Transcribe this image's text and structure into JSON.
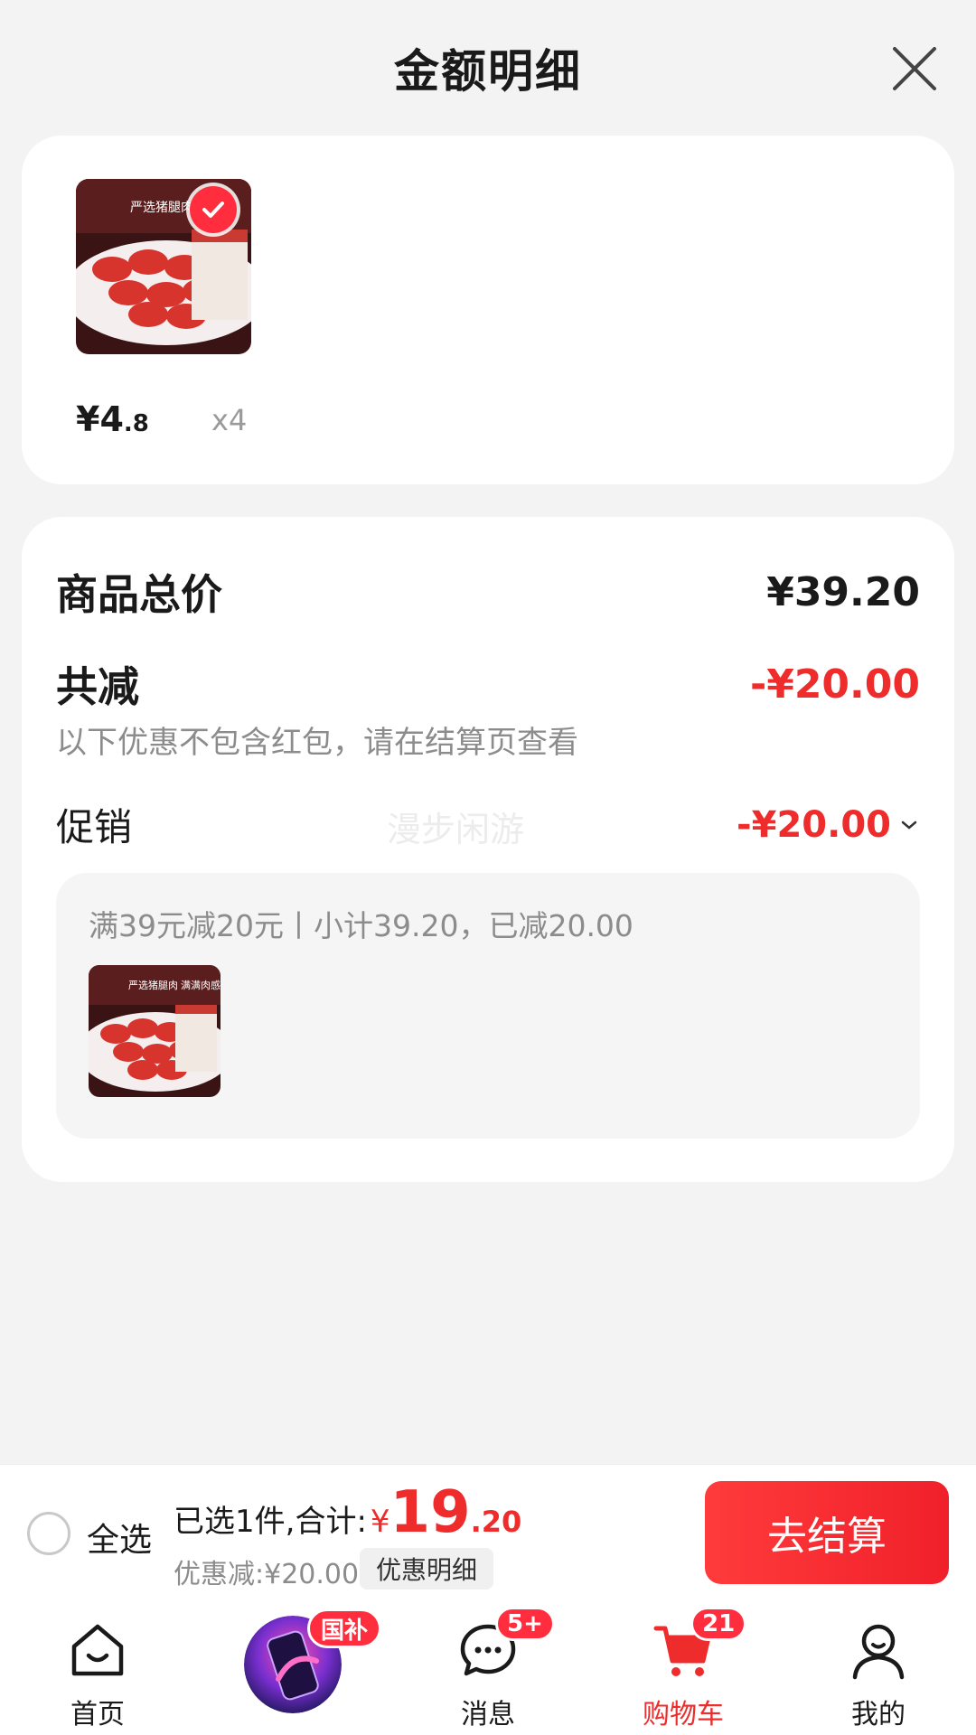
{
  "header": {
    "title": "金额明细"
  },
  "product": {
    "price_int": "¥4",
    "price_frac": ".8",
    "qty": "x4"
  },
  "summary": {
    "total_label": "商品总价",
    "total_value": "¥39.20",
    "discount_label": "共减",
    "discount_value": "-¥20.00",
    "note": "以下优惠不包含红包，请在结算页查看",
    "promo_label": "促销",
    "promo_value": "-¥20.00",
    "watermark": "漫步闲游",
    "promo_desc": "满39元减20元丨小计39.20，已减20.00"
  },
  "thumb_text": {
    "line1": "严选猪腿肉",
    "line2": "满满肉感"
  },
  "bottom_bar": {
    "select_all": "全选",
    "selected_text": "已选1件,合计:",
    "currency": "¥",
    "total_int": "19",
    "total_frac": ".20",
    "discount_text": "优惠减:¥20.00",
    "detail_button": "优惠明细",
    "checkout": "去结算"
  },
  "tabs": [
    {
      "label": "首页",
      "icon": "home-icon"
    },
    {
      "label": "",
      "icon": "promo-phone-icon",
      "badge": "国补"
    },
    {
      "label": "消息",
      "icon": "message-icon",
      "badge": "5+"
    },
    {
      "label": "购物车",
      "icon": "cart-icon",
      "badge": "21"
    },
    {
      "label": "我的",
      "icon": "profile-icon"
    }
  ],
  "colors": {
    "accent": "#ee2c2c",
    "background": "#f3f3f3"
  }
}
